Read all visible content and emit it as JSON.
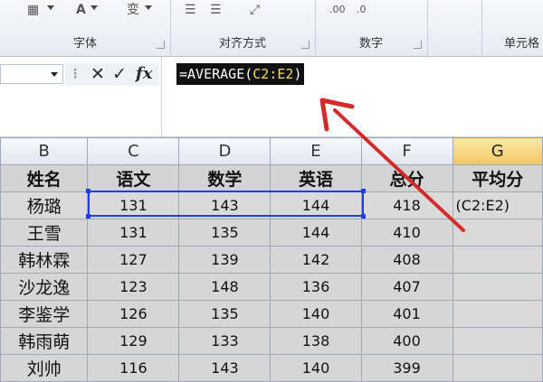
{
  "ribbon": {
    "groups": [
      {
        "label": "字体"
      },
      {
        "label": "对齐方式"
      },
      {
        "label": "数字"
      },
      {
        "label": "单元格"
      }
    ]
  },
  "formula_bar": {
    "cancel_icon": "✕",
    "enter_icon": "✓",
    "fx_label": "fx",
    "formula_prefix": "=AVERAGE(",
    "formula_ref": "C2:E2",
    "formula_suffix": ")"
  },
  "sheet": {
    "columns": [
      "B",
      "C",
      "D",
      "E",
      "F",
      "G"
    ],
    "selected_column": "G",
    "header_row": [
      "姓名",
      "语文",
      "数学",
      "英语",
      "总分",
      "平均分"
    ],
    "rows": [
      {
        "name": "杨璐",
        "c": "131",
        "d": "143",
        "e": "144",
        "f": "418",
        "g": "(C2:E2)"
      },
      {
        "name": "王雪",
        "c": "131",
        "d": "135",
        "e": "144",
        "f": "410",
        "g": ""
      },
      {
        "name": "韩林霖",
        "c": "127",
        "d": "139",
        "e": "142",
        "f": "408",
        "g": ""
      },
      {
        "name": "沙龙逸",
        "c": "123",
        "d": "148",
        "e": "136",
        "f": "407",
        "g": ""
      },
      {
        "name": "李鉴学",
        "c": "126",
        "d": "135",
        "e": "140",
        "f": "401",
        "g": ""
      },
      {
        "name": "韩雨萌",
        "c": "129",
        "d": "133",
        "e": "138",
        "f": "400",
        "g": ""
      },
      {
        "name": "刘帅",
        "c": "116",
        "d": "143",
        "e": "140",
        "f": "399",
        "g": ""
      }
    ]
  },
  "colors": {
    "selection_border": "#1f3fe0",
    "annotation_arrow": "#d42a2a",
    "formula_ref": "#f0e046"
  }
}
